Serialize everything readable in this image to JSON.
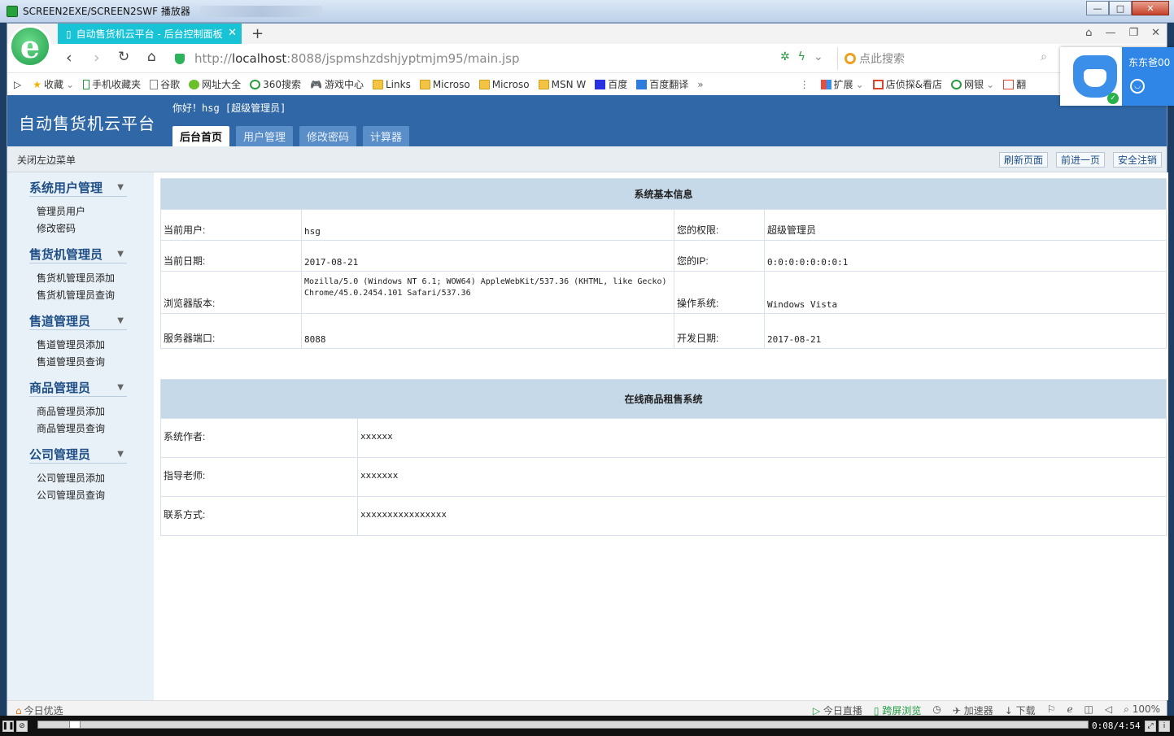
{
  "window": {
    "title": "SCREEN2EXE/SCREEN2SWF 播放器",
    "min": "—",
    "max": "□",
    "close": "✕"
  },
  "browser": {
    "tab_title": "自动售货机云平台 - 后台控制面板",
    "tab_close": "✕",
    "new_tab": "+",
    "address": {
      "scheme": "http://",
      "host": "localhost",
      "path": ":8088/jspmshzdshjyptmjm95/main.jsp"
    },
    "search_placeholder": "点此搜索",
    "bookmarks": [
      {
        "label": "收藏",
        "icon": "star-icon"
      },
      {
        "label": "手机收藏夹",
        "icon": "phone-icon"
      },
      {
        "label": "谷歌",
        "icon": "page-icon"
      },
      {
        "label": "网址大全",
        "icon": "globe-icon"
      },
      {
        "label": "360搜索",
        "icon": "search-icon"
      },
      {
        "label": "游戏中心",
        "icon": "gamepad-icon"
      },
      {
        "label": "Links",
        "icon": "folder-icon"
      },
      {
        "label": "Microso",
        "icon": "folder-icon"
      },
      {
        "label": "Microso",
        "icon": "folder-icon"
      },
      {
        "label": "MSN W",
        "icon": "folder-icon"
      },
      {
        "label": "百度",
        "icon": "baidu-icon"
      },
      {
        "label": "百度翻译",
        "icon": "translate-icon"
      }
    ],
    "bookmarks_right": [
      {
        "label": "扩展",
        "icon": "grid-icon"
      },
      {
        "label": "店侦探&看店",
        "icon": "shop-icon"
      },
      {
        "label": "网银",
        "icon": "bank-icon"
      },
      {
        "label": "翻",
        "icon": "ad-icon"
      }
    ],
    "popup_text": "东东爸00",
    "status_left": "今日优选",
    "status_right": [
      "今日直播",
      "跨屏浏览",
      "加速器",
      "下载",
      "100%"
    ]
  },
  "page": {
    "brand": "自动售货机云平台",
    "greeting": "你好！hsg [超级管理员]",
    "nav_tabs": [
      "后台首页",
      "用户管理",
      "修改密码",
      "计算器"
    ],
    "toggle_menu": "关闭左边菜单",
    "toolbar_buttons": [
      "刷新页面",
      "前进一页",
      "安全注销"
    ],
    "menu": [
      {
        "title": "系统用户管理",
        "items": [
          "管理员用户",
          "修改密码"
        ]
      },
      {
        "title": "售货机管理员",
        "items": [
          "售货机管理员添加",
          "售货机管理员查询"
        ]
      },
      {
        "title": "售道管理员",
        "items": [
          "售道管理员添加",
          "售道管理员查询"
        ]
      },
      {
        "title": "商品管理员",
        "items": [
          "商品管理员添加",
          "商品管理员查询"
        ]
      },
      {
        "title": "公司管理员",
        "items": [
          "公司管理员添加",
          "公司管理员查询"
        ]
      }
    ],
    "sysinfo": {
      "title": "系统基本信息",
      "rows": [
        {
          "l1": "当前用户:",
          "v1": "hsg",
          "l2": "您的权限:",
          "v2": "超级管理员"
        },
        {
          "l1": "当前日期:",
          "v1": "2017-08-21",
          "l2": "您的IP:",
          "v2": "0:0:0:0:0:0:0:1"
        },
        {
          "l1": "浏览器版本:",
          "v1": "Mozilla/5.0 (Windows NT 6.1; WOW64) AppleWebKit/537.36 (KHTML, like Gecko) Chrome/45.0.2454.101 Safari/537.36",
          "l2": "操作系统:",
          "v2": "Windows Vista"
        },
        {
          "l1": "服务器端口:",
          "v1": "8088",
          "l2": "开发日期:",
          "v2": "2017-08-21"
        }
      ]
    },
    "project": {
      "title": "在线商品租售系统",
      "rows": [
        {
          "label": "系统作者:",
          "value": "xxxxxx"
        },
        {
          "label": "指导老师:",
          "value": "xxxxxxx"
        },
        {
          "label": "联系方式:",
          "value": "xxxxxxxxxxxxxxxx"
        }
      ]
    }
  },
  "player": {
    "time": "0:08/4:54",
    "progress": 0.03
  }
}
